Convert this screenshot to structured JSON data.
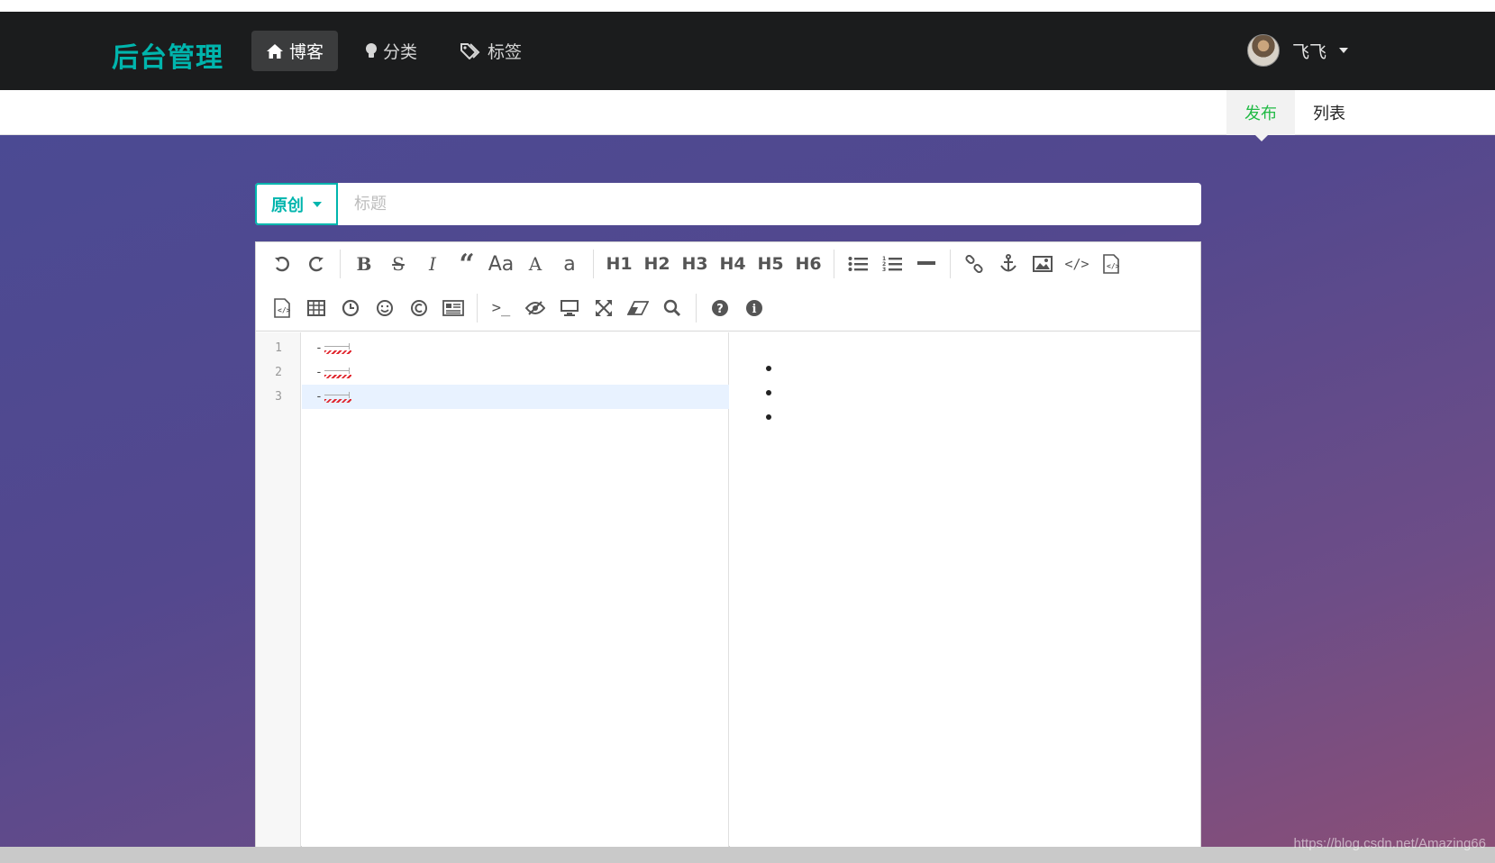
{
  "app": {
    "brand": "后台管理",
    "brand_color": "#00b5ad",
    "accent_green": "#21ba45"
  },
  "nav": {
    "items": [
      {
        "label": "博客",
        "icon": "home-icon",
        "active": true
      },
      {
        "label": "分类",
        "icon": "lightbulb-icon",
        "active": false
      },
      {
        "label": "标签",
        "icon": "tags-icon",
        "active": false
      }
    ],
    "user_name": "飞飞"
  },
  "subnav": {
    "tabs": [
      {
        "label": "发布",
        "active": true
      },
      {
        "label": "列表",
        "active": false
      }
    ]
  },
  "editor_form": {
    "type_dropdown": "原创",
    "title_placeholder": "标题",
    "title_value": ""
  },
  "toolbar": {
    "row1": [
      "undo-icon",
      "redo-icon",
      "bold-icon",
      "strikethrough-icon",
      "italic-icon",
      "quote-icon",
      "uppercase-icon",
      "ucwords-icon",
      "lowercase-icon",
      "h1",
      "h2",
      "h3",
      "h4",
      "h5",
      "h6",
      "list-ul-icon",
      "list-ol-icon",
      "hr-icon",
      "link-icon",
      "anchor-icon",
      "image-icon",
      "code-icon",
      "preformatted-text-icon"
    ],
    "row2": [
      "code-block-icon",
      "table-icon",
      "datetime-icon",
      "emoji-icon",
      "html-entities-icon",
      "pagebreak-icon",
      "goto-line-icon",
      "unwatch-icon",
      "preview-icon",
      "fullscreen-icon",
      "clear-icon",
      "search-icon",
      "help-icon",
      "info-icon"
    ],
    "heading_labels": [
      "H1",
      "H2",
      "H3",
      "H4",
      "H5",
      "H6"
    ],
    "case_labels": [
      "Aa",
      "A",
      "a"
    ]
  },
  "code": {
    "line_numbers": [
      "1",
      "2",
      "3"
    ],
    "lines": [
      "-",
      "-",
      "-"
    ],
    "active_line": 3
  },
  "preview": {
    "bullet_count": 3
  },
  "watermark": "https://blog.csdn.net/Amazing66"
}
